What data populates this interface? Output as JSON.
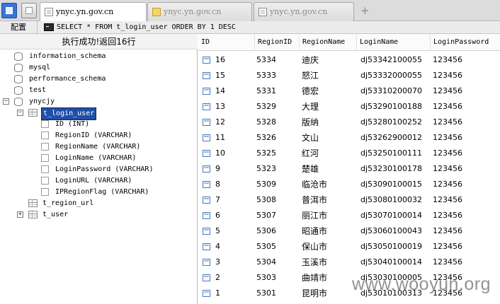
{
  "tabs": [
    {
      "label": "ynyc.yn.gov.cn",
      "icon": "page-icon",
      "active": true
    },
    {
      "label": "ynyc.yn.gov.cn",
      "icon": "folder-icon",
      "active": false
    },
    {
      "label": "ynyc.yn.gov.cn",
      "icon": "page-icon",
      "active": false
    }
  ],
  "new_tab": "+",
  "toolbar": {
    "config_label": "配置",
    "sql": "SELECT * FROM t_login_user ORDER BY 1 DESC"
  },
  "left": {
    "status": "执行成功!返回16行",
    "databases": [
      "information_schema",
      "mysql",
      "performance_schema",
      "test",
      "ynycjy"
    ],
    "tables": [
      {
        "name": "t_login_user",
        "expanded": true,
        "selected": true
      },
      {
        "name": "t_region_url",
        "expanded": false
      },
      {
        "name": "t_user",
        "expanded": false
      }
    ],
    "columns": [
      "ID (INT)",
      "RegionID (VARCHAR)",
      "RegionName (VARCHAR)",
      "LoginName (VARCHAR)",
      "LoginPassword (VARCHAR)",
      "LoginURL (VARCHAR)",
      "IPRegionFlag (VARCHAR)"
    ],
    "expand_minus": "−",
    "expand_plus": "+"
  },
  "grid": {
    "headers": [
      "ID",
      "RegionID",
      "RegionName",
      "LoginName",
      "LoginPassword"
    ],
    "rows": [
      {
        "id": "16",
        "region_id": "5334",
        "region_name": "迪庆",
        "login_name": "dj53342100055",
        "password": "123456"
      },
      {
        "id": "15",
        "region_id": "5333",
        "region_name": "怒江",
        "login_name": "dj53332000055",
        "password": "123456"
      },
      {
        "id": "14",
        "region_id": "5331",
        "region_name": "德宏",
        "login_name": "dj53310200070",
        "password": "123456"
      },
      {
        "id": "13",
        "region_id": "5329",
        "region_name": "大理",
        "login_name": "dj53290100188",
        "password": "123456"
      },
      {
        "id": "12",
        "region_id": "5328",
        "region_name": "版纳",
        "login_name": "dj53280100252",
        "password": "123456"
      },
      {
        "id": "11",
        "region_id": "5326",
        "region_name": "文山",
        "login_name": "dj53262900012",
        "password": "123456"
      },
      {
        "id": "10",
        "region_id": "5325",
        "region_name": "红河",
        "login_name": "dj53250100111",
        "password": "123456"
      },
      {
        "id": "9",
        "region_id": "5323",
        "region_name": "楚雄",
        "login_name": "dj53230100178",
        "password": "123456"
      },
      {
        "id": "8",
        "region_id": "5309",
        "region_name": "临沧市",
        "login_name": "dj53090100015",
        "password": "123456"
      },
      {
        "id": "7",
        "region_id": "5308",
        "region_name": "普洱市",
        "login_name": "dj53080100032",
        "password": "123456"
      },
      {
        "id": "6",
        "region_id": "5307",
        "region_name": "丽江市",
        "login_name": "dj53070100014",
        "password": "123456"
      },
      {
        "id": "5",
        "region_id": "5306",
        "region_name": "昭通市",
        "login_name": "dj53060100043",
        "password": "123456"
      },
      {
        "id": "4",
        "region_id": "5305",
        "region_name": "保山市",
        "login_name": "dj53050100019",
        "password": "123456"
      },
      {
        "id": "3",
        "region_id": "5304",
        "region_name": "玉溪市",
        "login_name": "dj53040100014",
        "password": "123456"
      },
      {
        "id": "2",
        "region_id": "5303",
        "region_name": "曲靖市",
        "login_name": "dj53030100005",
        "password": "123456"
      },
      {
        "id": "1",
        "region_id": "5301",
        "region_name": "昆明市",
        "login_name": "dj53010100313",
        "password": "123456"
      }
    ]
  },
  "watermark": "www.wooyun.org"
}
